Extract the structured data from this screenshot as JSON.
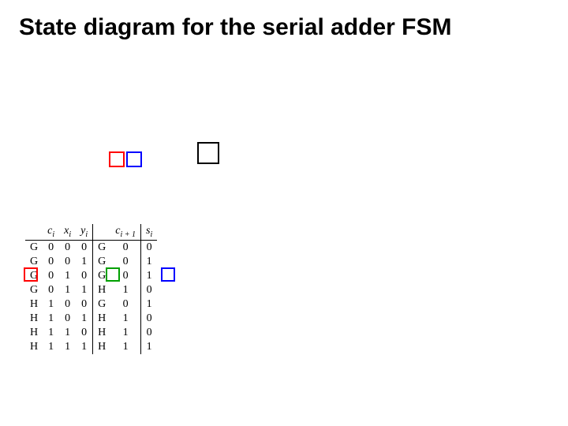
{
  "title": "State diagram for the serial adder FSM",
  "headers": {
    "c_i": "c",
    "c_i_sub": "i",
    "x_i": "x",
    "x_i_sub": "i",
    "y_i": "y",
    "y_i_sub": "i",
    "c_i1": "c",
    "c_i1_sub": "i + 1",
    "s_i": "s",
    "s_i_sub": "i"
  },
  "rows": [
    {
      "state_in": "G",
      "ci": "0",
      "xi": "0",
      "yi": "0",
      "state_out": "G",
      "ci1": "0",
      "si": "0"
    },
    {
      "state_in": "G",
      "ci": "0",
      "xi": "0",
      "yi": "1",
      "state_out": "G",
      "ci1": "0",
      "si": "1"
    },
    {
      "state_in": "G",
      "ci": "0",
      "xi": "1",
      "yi": "0",
      "state_out": "G",
      "ci1": "0",
      "si": "1"
    },
    {
      "state_in": "G",
      "ci": "0",
      "xi": "1",
      "yi": "1",
      "state_out": "H",
      "ci1": "1",
      "si": "0"
    },
    {
      "state_in": "H",
      "ci": "1",
      "xi": "0",
      "yi": "0",
      "state_out": "G",
      "ci1": "0",
      "si": "1"
    },
    {
      "state_in": "H",
      "ci": "1",
      "xi": "0",
      "yi": "1",
      "state_out": "H",
      "ci1": "1",
      "si": "0"
    },
    {
      "state_in": "H",
      "ci": "1",
      "xi": "1",
      "yi": "0",
      "state_out": "H",
      "ci1": "1",
      "si": "0"
    },
    {
      "state_in": "H",
      "ci": "1",
      "xi": "1",
      "yi": "1",
      "state_out": "H",
      "ci1": "1",
      "si": "1"
    }
  ]
}
